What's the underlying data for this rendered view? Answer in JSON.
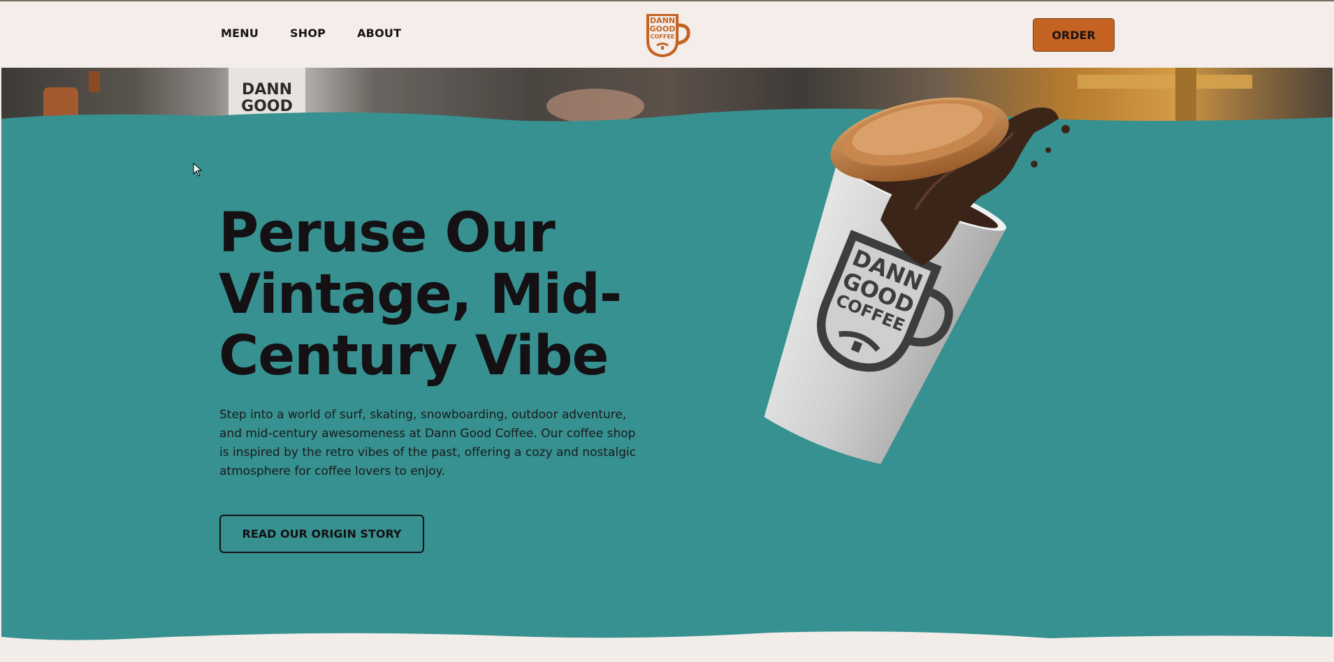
{
  "header": {
    "nav": [
      {
        "label": "MENU"
      },
      {
        "label": "SHOP"
      },
      {
        "label": "ABOUT"
      }
    ],
    "logo_text": [
      "DANN",
      "GOOD",
      "COFFEE"
    ],
    "order_label": "ORDER"
  },
  "hero": {
    "headline": "Peruse Our Vintage, Mid-Century Vibe",
    "intro": "Step into a world of surf, skating, snowboarding, outdoor adventure, and mid-century awesomeness at Dann Good Coffee. Our coffee shop is inspired by the retro vibes of the past, offering a cozy and nostalgic atmosphere for coffee lovers to enjoy.",
    "cta_label": "READ OUR ORIGIN STORY",
    "cup_logo_text": [
      "DANN",
      "GOOD",
      "COFFEE"
    ]
  },
  "colors": {
    "header_bg": "#f4edea",
    "teal": "#369190",
    "accent": "#c46322",
    "text": "#141013"
  },
  "icons": {
    "cursor": "arrow-cursor-icon",
    "logo": "mug-logo-icon"
  }
}
